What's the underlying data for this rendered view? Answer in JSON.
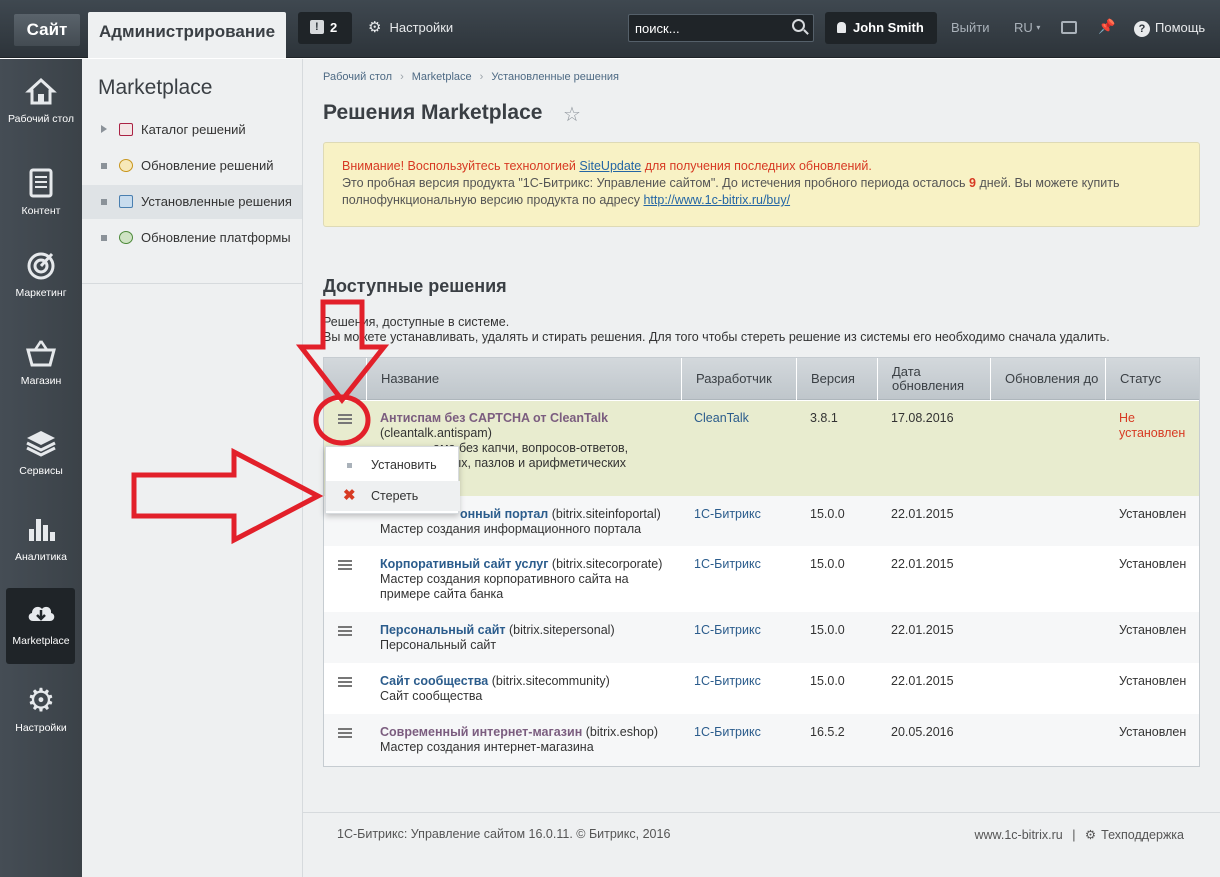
{
  "topbar": {
    "site_tab": "Сайт",
    "admin_tab": "Администрирование",
    "notifications_count": "2",
    "settings_label": "Настройки",
    "search_placeholder": "поиск...",
    "user_name": "John Smith",
    "logout_label": "Выйти",
    "lang_label": "RU",
    "help_label": "Помощь"
  },
  "left_menu": [
    {
      "label": "Рабочий стол"
    },
    {
      "label": "Контент"
    },
    {
      "label": "Маркетинг"
    },
    {
      "label": "Магазин"
    },
    {
      "label": "Сервисы"
    },
    {
      "label": "Аналитика"
    },
    {
      "label": "Marketplace"
    },
    {
      "label": "Настройки"
    }
  ],
  "submenu": {
    "title": "Marketplace",
    "items": [
      {
        "label": "Каталог решений"
      },
      {
        "label": "Обновление решений"
      },
      {
        "label": "Установленные решения"
      },
      {
        "label": "Обновление платформы"
      }
    ]
  },
  "breadcrumb": [
    "Рабочий стол",
    "Marketplace",
    "Установленные решения"
  ],
  "page_title": "Решения Marketplace",
  "alert": {
    "line1_a": "Внимание! Воспользуйтесь технологией ",
    "line1_link": "SiteUpdate",
    "line1_b": " для получения последних обновлений.",
    "line2_a": "Это пробная версия продукта \"1С-Битрикс: Управление сайтом\". До истечения пробного периода осталось ",
    "line2_days": "9",
    "line2_b": " дней. Вы можете купить",
    "line3_a": "полнофункциональную версию продукта по адресу ",
    "line3_link": "http://www.1c-bitrix.ru/buy/"
  },
  "section": {
    "title": "Доступные решения",
    "desc1": "Решения, доступные в системе.",
    "desc2": "Вы можете устанавливать, удалять и стирать решения. Для того чтобы стереть решение из системы его необходимо сначала удалить."
  },
  "table": {
    "headers": [
      "Название",
      "Разработчик",
      "Версия",
      "Дата обновления",
      "Обновления до",
      "Статус"
    ],
    "rows": [
      {
        "name": "Антиспам без CAPTCHA от CleanTalk",
        "code": "(cleantalk.antispam)",
        "desc1": "ама без капчи, вопросов-ответов,",
        "desc2": "отных, пазлов и арифметических",
        "dev": "CleanTalk",
        "version": "3.8.1",
        "date": "17.08.2016",
        "status": "Не установлен"
      },
      {
        "name": "онный портал",
        "code": "(bitrix.siteinfoportal)",
        "desc1": "Мастер создания информационного портала",
        "desc2": "",
        "dev": "1С-Битрикс",
        "version": "15.0.0",
        "date": "22.01.2015",
        "status": "Установлен"
      },
      {
        "name": "Корпоративный сайт услуг",
        "code": "(bitrix.sitecorporate)",
        "desc1": "Мастер создания корпоративного сайта на",
        "desc2": "примере сайта банка",
        "dev": "1С-Битрикс",
        "version": "15.0.0",
        "date": "22.01.2015",
        "status": "Установлен"
      },
      {
        "name": "Персональный сайт",
        "code": "(bitrix.sitepersonal)",
        "desc1": "Персональный сайт",
        "desc2": "",
        "dev": "1С-Битрикс",
        "version": "15.0.0",
        "date": "22.01.2015",
        "status": "Установлен"
      },
      {
        "name": "Сайт сообщества",
        "code": "(bitrix.sitecommunity)",
        "desc1": "Сайт сообщества",
        "desc2": "",
        "dev": "1С-Битрикс",
        "version": "15.0.0",
        "date": "22.01.2015",
        "status": "Установлен"
      },
      {
        "name": "Современный интернет-магазин",
        "code": "(bitrix.eshop)",
        "desc1": "Мастер создания интернет-магазина",
        "desc2": "",
        "dev": "1С-Битрикс",
        "version": "16.5.2",
        "date": "20.05.2016",
        "status": "Установлен"
      }
    ]
  },
  "popup": {
    "install": "Установить",
    "erase": "Стереть"
  },
  "footer": {
    "left": "1С-Битрикс: Управление сайтом 16.0.11. © Битрикс, 2016",
    "site": "www.1c-bitrix.ru",
    "separator": "|",
    "support": "Техподдержка"
  },
  "colors": {
    "annotation_red": "#e2202a",
    "alert_red": "#d73a23",
    "link_blue": "#2b5c8c"
  }
}
